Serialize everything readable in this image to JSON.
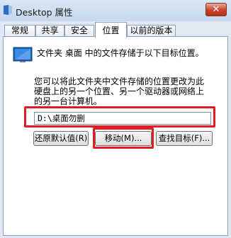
{
  "window": {
    "title": "Desktop 属性",
    "close_glyph": "✕"
  },
  "tabs": [
    {
      "label": "常规"
    },
    {
      "label": "共享"
    },
    {
      "label": "安全"
    },
    {
      "label": "位置",
      "active": true
    },
    {
      "label": "以前的版本"
    }
  ],
  "location": {
    "desc1": "文件夹 桌面 中的文件存储于以下目标位置。",
    "desc2": "您可以将此文件夹中文件存储的位置更改为此硬盘上的另一个位置、另一个驱动器或网络上的另一台计算机。",
    "path_value": "D:\\桌面勿删"
  },
  "buttons": {
    "restore_default": "还原默认值(R)",
    "move": "移动(M)...",
    "find_target": "查找目标(F)..."
  },
  "colors": {
    "highlight": "#e01b23",
    "window_bg": "#dfe8f3"
  }
}
